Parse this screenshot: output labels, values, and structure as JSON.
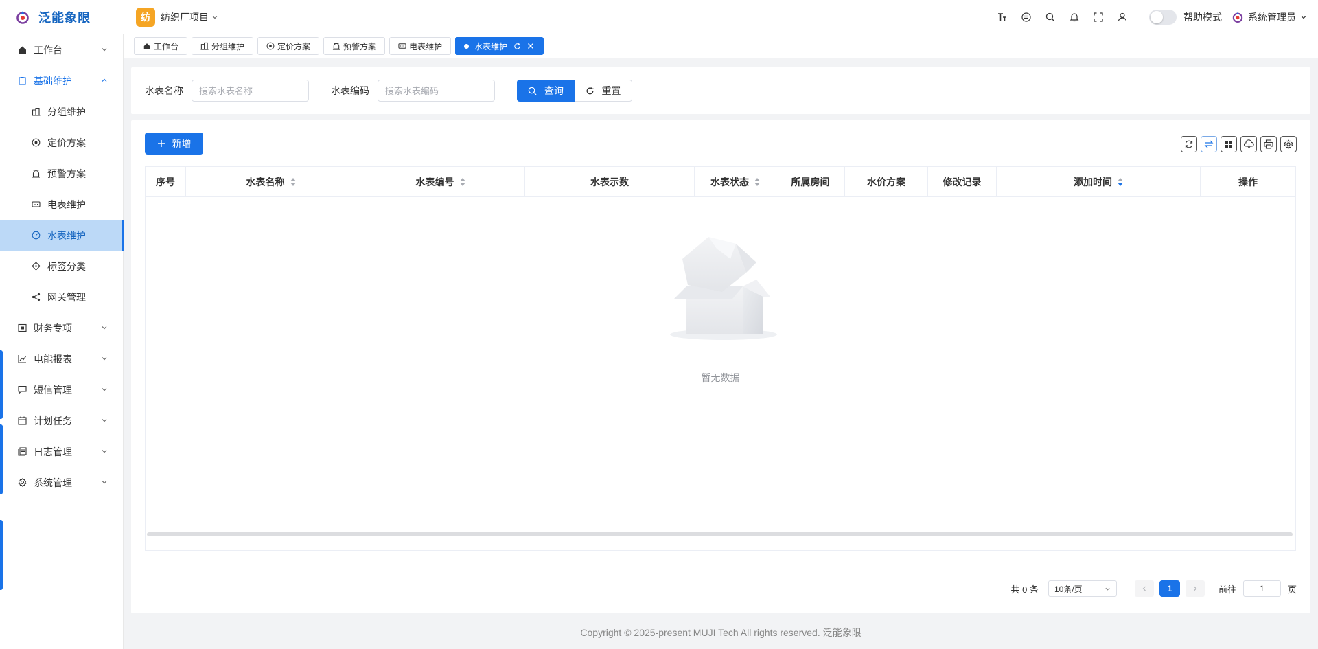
{
  "app": {
    "name": "泛能象限",
    "brand_color": "#1a73e8"
  },
  "project": {
    "badge": "纺",
    "name": "纺织厂项目"
  },
  "header": {
    "icons": [
      "font-size-icon",
      "language-icon",
      "search-icon",
      "bell-icon",
      "fullscreen-icon",
      "user-icon"
    ],
    "help_mode_label": "帮助模式",
    "help_mode_on": false,
    "user_name": "系统管理员"
  },
  "sidebar": {
    "items": [
      {
        "label": "工作台",
        "icon": "home-icon",
        "caret": "down"
      },
      {
        "label": "基础维护",
        "icon": "clipboard-icon",
        "caret": "up",
        "open": true
      },
      {
        "label": "分组维护",
        "icon": "building-icon",
        "sub": true
      },
      {
        "label": "定价方案",
        "icon": "price-icon",
        "sub": true
      },
      {
        "label": "预警方案",
        "icon": "alarm-icon",
        "sub": true
      },
      {
        "label": "电表维护",
        "icon": "meter-icon",
        "sub": true
      },
      {
        "label": "水表维护",
        "icon": "gauge-icon",
        "sub": true,
        "active": true
      },
      {
        "label": "标签分类",
        "icon": "tag-icon",
        "sub": true
      },
      {
        "label": "网关管理",
        "icon": "share-icon",
        "sub": true
      },
      {
        "label": "财务专项",
        "icon": "finance-icon",
        "caret": "down"
      },
      {
        "label": "电能报表",
        "icon": "chart-icon",
        "caret": "down"
      },
      {
        "label": "短信管理",
        "icon": "message-icon",
        "caret": "down"
      },
      {
        "label": "计划任务",
        "icon": "calendar-icon",
        "caret": "down"
      },
      {
        "label": "日志管理",
        "icon": "log-icon",
        "caret": "down"
      },
      {
        "label": "系统管理",
        "icon": "gear-icon",
        "caret": "down"
      }
    ]
  },
  "tabs": [
    {
      "label": "工作台",
      "icon": "home-icon"
    },
    {
      "label": "分组维护",
      "icon": "building-icon"
    },
    {
      "label": "定价方案",
      "icon": "price-icon"
    },
    {
      "label": "预警方案",
      "icon": "alarm-icon"
    },
    {
      "label": "电表维护",
      "icon": "meter-icon"
    },
    {
      "label": "水表维护",
      "active": true
    }
  ],
  "search": {
    "name_label": "水表名称",
    "name_placeholder": "搜索水表名称",
    "code_label": "水表编码",
    "code_placeholder": "搜索水表编码",
    "query_label": "查询",
    "reset_label": "重置"
  },
  "toolbar": {
    "add_label": "新增",
    "tools": [
      "refresh-icon",
      "swap-icon",
      "grid-icon",
      "cloud-download-icon",
      "print-icon",
      "settings-icon"
    ]
  },
  "table": {
    "columns": [
      {
        "label": "序号"
      },
      {
        "label": "水表名称",
        "sortable": true
      },
      {
        "label": "水表编号",
        "sortable": true
      },
      {
        "label": "水表示数"
      },
      {
        "label": "水表状态",
        "sortable": true
      },
      {
        "label": "所属房间"
      },
      {
        "label": "水价方案"
      },
      {
        "label": "修改记录"
      },
      {
        "label": "添加时间",
        "sortable": true,
        "sort": "desc"
      },
      {
        "label": "操作"
      }
    ],
    "rows": [],
    "empty_text": "暂无数据"
  },
  "pagination": {
    "total_text": "共 0 条",
    "page_size": "10条/页",
    "current_page": "1",
    "goto_label": "前往",
    "goto_value": "1",
    "page_suffix": "页"
  },
  "footer": {
    "copyright": "Copyright © 2025-present MUJI Tech All rights reserved. 泛能象限"
  }
}
